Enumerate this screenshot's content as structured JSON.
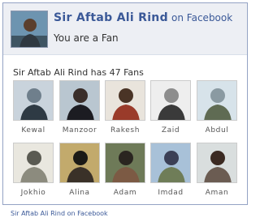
{
  "header": {
    "page_name": "Sir Aftab Ali Rind",
    "on_platform": "on Facebook",
    "fan_status": "You are a Fan"
  },
  "fans": {
    "heading": "Sir Aftab Ali Rind has 47 Fans",
    "list": [
      {
        "name": "Kewal",
        "photo_colors": [
          "#c9d3dc",
          "#6f7f8c",
          "#2e3a44"
        ]
      },
      {
        "name": "Manzoor",
        "photo_colors": [
          "#b9c6d0",
          "#3a2e2a",
          "#1c1c22"
        ]
      },
      {
        "name": "Rakesh",
        "photo_colors": [
          "#e9e4dc",
          "#4a3426",
          "#9a3b2a"
        ]
      },
      {
        "name": "Zaid",
        "photo_colors": [
          "#eeeeee",
          "#8d8d8d",
          "#3a3a3a"
        ]
      },
      {
        "name": "Abdul",
        "photo_colors": [
          "#d7e3ea",
          "#8a9aa2",
          "#5f6b53"
        ]
      },
      {
        "name": "Jokhio",
        "photo_colors": [
          "#e9e7df",
          "#5a5a52",
          "#8c8b7e"
        ]
      },
      {
        "name": "Alina",
        "photo_colors": [
          "#c2aa6c",
          "#1b1a16",
          "#3a3128"
        ]
      },
      {
        "name": "Adam",
        "photo_colors": [
          "#6e7a58",
          "#2a2520",
          "#7c5a44"
        ]
      },
      {
        "name": "Imdad",
        "photo_colors": [
          "#a8c1d8",
          "#3b3f55",
          "#6f7d58"
        ]
      },
      {
        "name": "Aman",
        "photo_colors": [
          "#d9dede",
          "#3b2a22",
          "#6b5c52"
        ]
      }
    ]
  },
  "footer": {
    "link_text": "Sir Aftab Ali Rind on Facebook"
  },
  "colors": {
    "brand_blue": "#3b5998",
    "header_bg": "#edeff4",
    "border": "#94a3c4"
  }
}
